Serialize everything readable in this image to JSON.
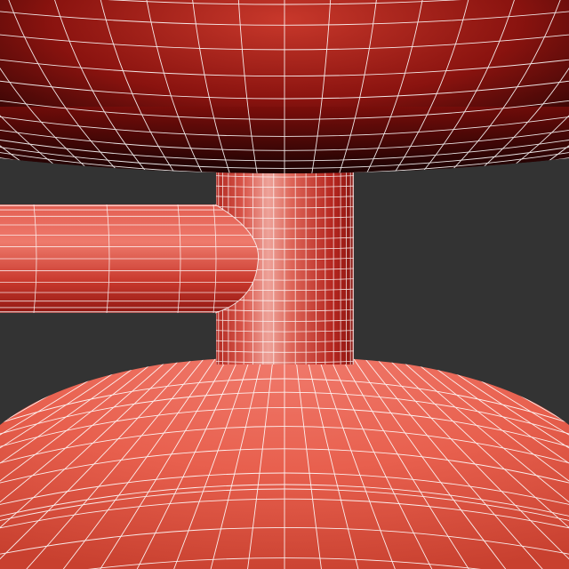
{
  "scene": {
    "description_visible_text": "",
    "colors": {
      "background": "#333333",
      "surface_light": "#e8604e",
      "surface_mid": "#c83a2c",
      "surface_dark": "#7a0f0c",
      "surface_deep": "#2a0404",
      "cylinder_highlight": "#f0a49c",
      "wire": "#ffffff"
    },
    "objects": [
      {
        "name": "upper-sphere",
        "kind": "sphere-underside"
      },
      {
        "name": "vertical-cylinder",
        "kind": "cylinder"
      },
      {
        "name": "horizontal-cylinder",
        "kind": "cylinder"
      },
      {
        "name": "lower-sphere",
        "kind": "sphere-top"
      }
    ]
  }
}
